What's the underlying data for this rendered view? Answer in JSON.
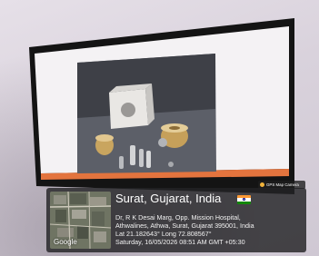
{
  "gps_badge": {
    "label": "GPS Map Camera"
  },
  "map": {
    "provider_label": "Google"
  },
  "location": {
    "title": "Surat, Gujarat, India",
    "address_line1": "Dr, R K Desai Marg, Opp. Mission Hospital,",
    "address_line2": "Athwalines, Athwa, Surat, Gujarat 395001, India",
    "coordinates": "Lat 21.182643° Long 72.808567°",
    "timestamp": "Saturday, 16/05/2026 08:51 AM GMT +05:30"
  },
  "colors": {
    "wall": "#d8d1db",
    "monitor_bezel": "#161616",
    "screen_bar": "#e3743e",
    "overlay": "#232326",
    "flag_saffron": "#ff9933",
    "flag_green": "#138808"
  }
}
